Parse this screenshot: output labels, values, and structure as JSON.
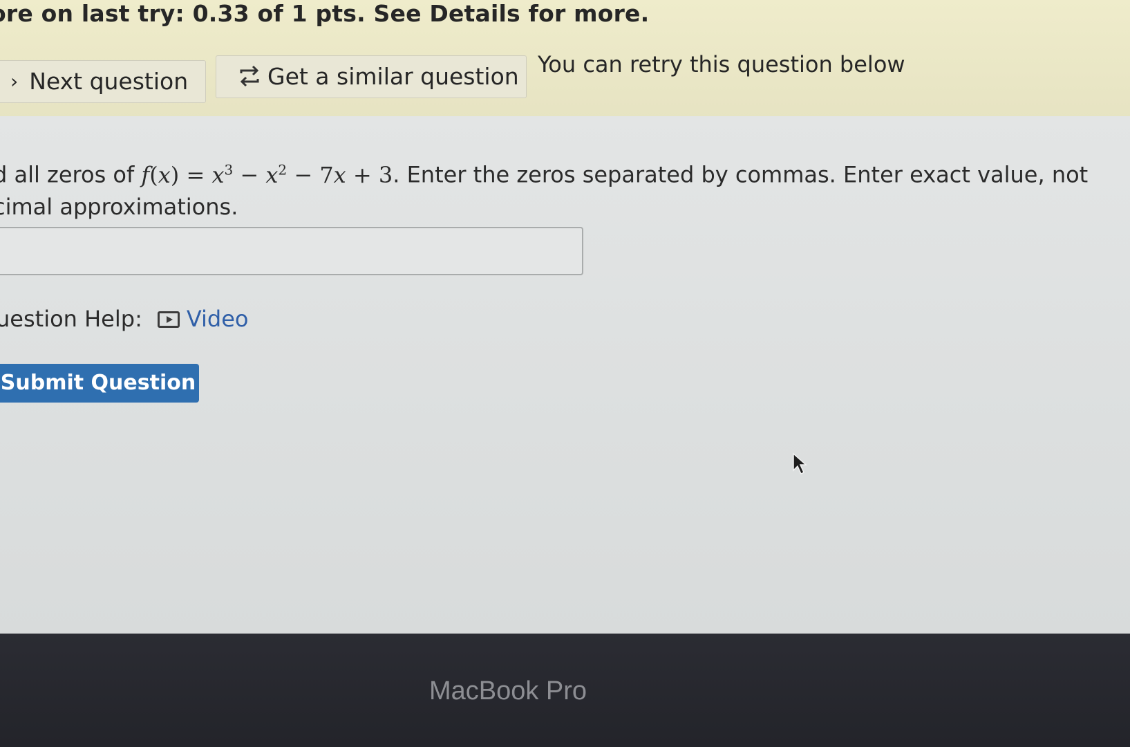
{
  "banner": {
    "score_text": "ore on last try: 0.33 of 1 pts. See Details for more.",
    "next_label": "Next question",
    "similar_label": "Get a similar question",
    "retry_text": "You can retry this question below"
  },
  "question": {
    "prefix": "d all zeros of",
    "function_name": "f",
    "variable": "x",
    "equals": "=",
    "exp1": "3",
    "minus": "−",
    "exp2": "2",
    "term3": "7",
    "plus": "+",
    "const": "3",
    "suffix_line1": ". Enter the zeros separated by commas. Enter exact value, not",
    "line2": "cimal approximations."
  },
  "answer": {
    "value": "",
    "placeholder": ""
  },
  "help": {
    "label": "uestion Help:",
    "video_label": "Video"
  },
  "submit": {
    "label": "Submit Question"
  },
  "bezel": {
    "label": "MacBook Pro"
  },
  "colors": {
    "submit_bg": "#2f6fb0",
    "link": "#2f5fa8",
    "banner": "#efeccb"
  },
  "icons": [
    "chevron-right-icon",
    "loop-arrows-icon",
    "video-icon",
    "mouse-cursor-icon"
  ]
}
